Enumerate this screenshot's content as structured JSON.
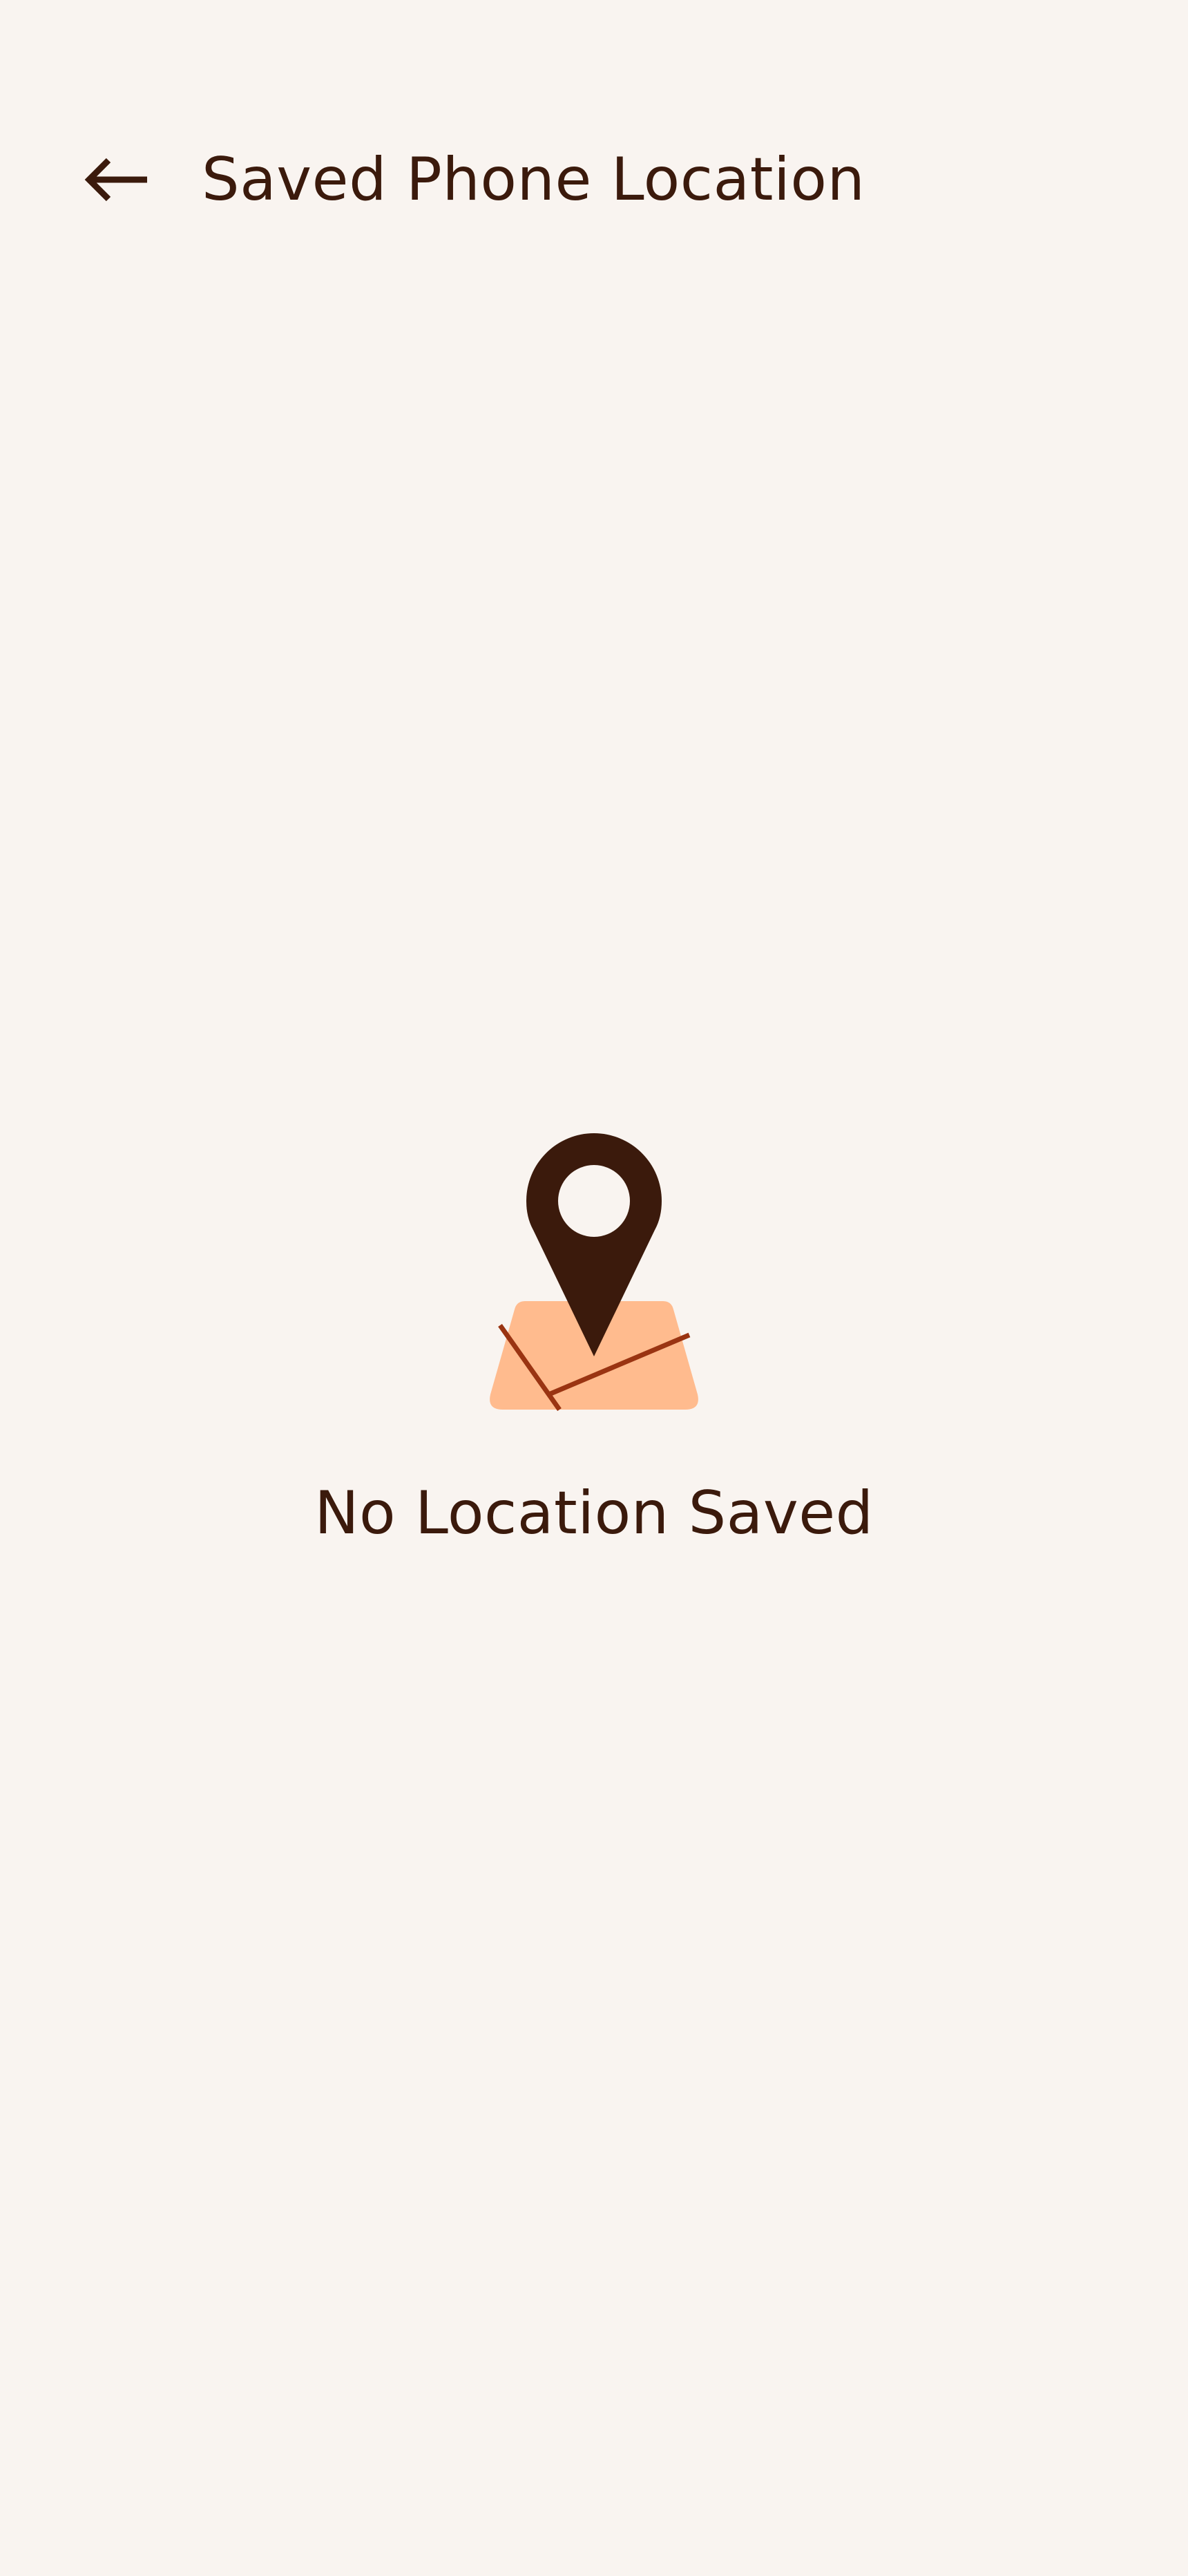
{
  "header": {
    "title": "Saved Phone Location",
    "back_icon": "arrow-left-icon"
  },
  "empty_state": {
    "message": "No Location Saved",
    "illustration_icons": [
      "map-pin-icon",
      "map-icon"
    ]
  },
  "colors": {
    "background": "#f9f4f0",
    "text": "#3b1a0c",
    "pin": "#3b1a0c",
    "map_fill": "#ffbb8e",
    "map_roads": "#9a3412"
  }
}
